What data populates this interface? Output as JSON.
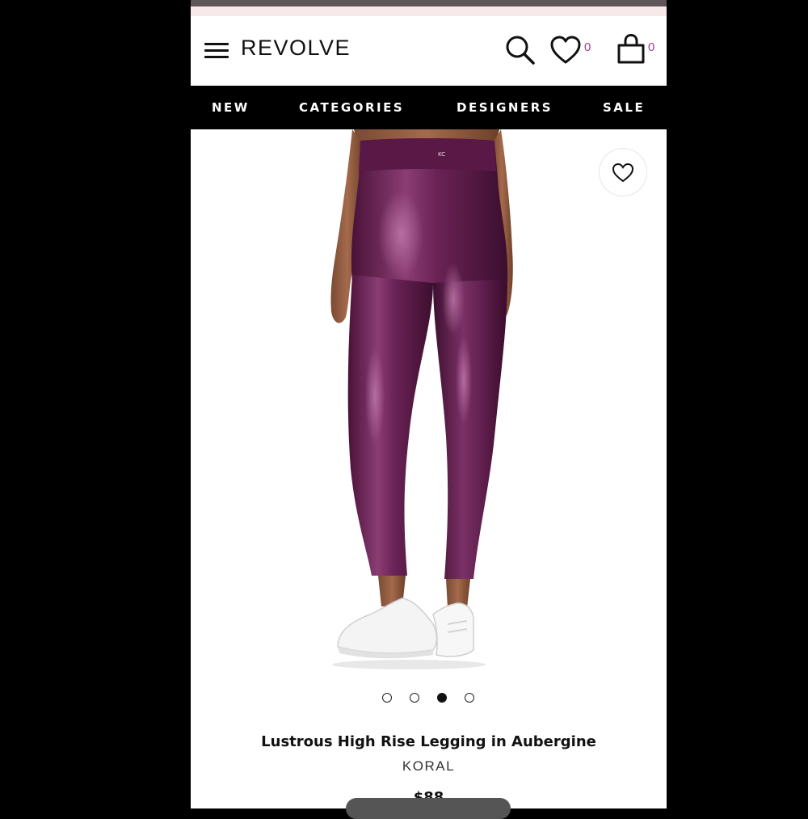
{
  "header": {
    "logo": "REVOLVE",
    "wishlist_count": "0",
    "bag_count": "0"
  },
  "nav": {
    "items": [
      "NEW",
      "CATEGORIES",
      "DESIGNERS",
      "SALE"
    ]
  },
  "product": {
    "title": "Lustrous High Rise Legging in Aubergine",
    "brand": "KORAL",
    "price": "$88",
    "waistband_logo": "KC",
    "image_count": 4,
    "active_image_index": 3
  },
  "colors": {
    "accent": "#9b3f8f",
    "nav_bg": "#000000",
    "legging": "#5e1a4a"
  },
  "icons": [
    "hamburger-menu-icon",
    "search-icon",
    "heart-icon",
    "shopping-bag-icon",
    "favorite-heart-icon"
  ]
}
